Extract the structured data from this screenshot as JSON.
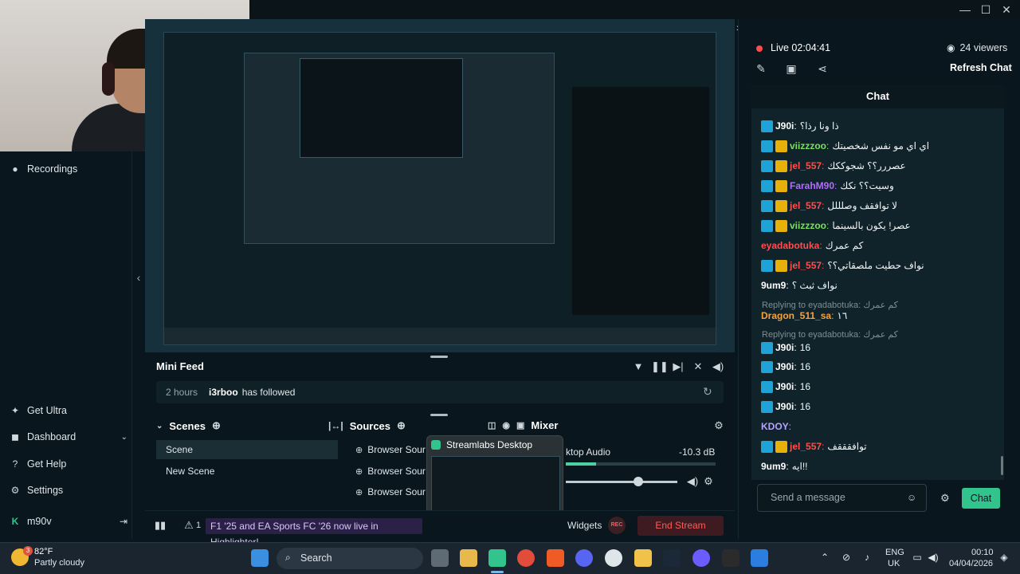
{
  "window": {
    "minimize": "—",
    "maximize": "☐",
    "close": "✕"
  },
  "sidebar": {
    "recordings": "Recordings",
    "get_ultra": "Get Ultra",
    "dashboard": "Dashboard",
    "get_help": "Get Help",
    "settings": "Settings",
    "user": "m90v"
  },
  "mini_feed": {
    "title": "Mini Feed",
    "event_time": "2 hours",
    "event_user": "i3rboo",
    "event_action": "has followed"
  },
  "scenes": {
    "title": "Scenes",
    "items": [
      "Scene",
      "New Scene"
    ]
  },
  "sources": {
    "title": "Sources",
    "items": [
      "Browser Sour",
      "Browser Sour",
      "Browser Sour"
    ]
  },
  "mixer": {
    "title": "Mixer",
    "device": "ktop Audio",
    "level": "-10.3 dB",
    "meter_fraction": 0.2,
    "volume_fraction": 0.65
  },
  "hover_preview": {
    "title": "Streamlabs Desktop"
  },
  "statusbar": {
    "promo": "F1 '25 and EA Sports FC '26 now live in Highlighter!",
    "widgets": "Widgets",
    "rec": "REC",
    "end_stream": "End Stream",
    "alert_count": "1"
  },
  "chat_panel": {
    "live_label": "Live",
    "live_time": "02:04:41",
    "viewers": "24 viewers",
    "refresh_chat": "Refresh Chat",
    "chat_title": "Chat",
    "send_placeholder": "Send a message",
    "chat_button": "Chat",
    "messages": [
      {
        "name": "J90i",
        "sep": ":",
        "text": "ذا ونا رذا؟",
        "color": "#ffffff",
        "badges": "mod"
      },
      {
        "name": "viizzzoo",
        "sep": ":",
        "text": "اي اي مو نفس شخصيتك",
        "color": "#7be05a",
        "badges": "mod-crown"
      },
      {
        "name": "jel_557",
        "sep": ":",
        "text": "عصررر؟؟ شجوككك",
        "color": "#ff4d4d",
        "badges": "mod-crown"
      },
      {
        "name": "FarahM90",
        "sep": ":",
        "text": "وسيت؟؟ نكك",
        "color": "#b36bff",
        "badges": "mod-crown"
      },
      {
        "name": "jel_557",
        "sep": ":",
        "text": "لا توافقف وصلللل",
        "color": "#ff4d4d",
        "badges": "mod-crown"
      },
      {
        "name": "viizzzoo",
        "sep": ":",
        "text": "عصر! يكون بالسينما",
        "color": "#7be05a",
        "badges": "mod-crown"
      },
      {
        "name": "eyadabotuka",
        "sep": ":",
        "text": "كم عمرك",
        "color": "#ff4d4d",
        "badges": ""
      },
      {
        "name": "jel_557",
        "sep": ":",
        "text": "نواف حطيت ملصقاتي؟؟",
        "color": "#ff4d4d",
        "badges": "mod-crown"
      },
      {
        "name": "9um9",
        "sep": ":",
        "text": "نواف ثبث ؟",
        "color": "#ffffff",
        "badges": ""
      },
      {
        "name": "Dragon_511_sa",
        "sep": ":",
        "text": "١٦",
        "color": "#f7a23b",
        "badges": ""
      },
      {
        "name": "J90i",
        "sep": ":",
        "text": "16",
        "color": "#ffffff",
        "badges": "mod"
      },
      {
        "name": "J90i",
        "sep": ":",
        "text": "16",
        "color": "#ffffff",
        "badges": "mod"
      },
      {
        "name": "J90i",
        "sep": ":",
        "text": "16",
        "color": "#ffffff",
        "badges": "mod"
      },
      {
        "name": "J90i",
        "sep": ":",
        "text": "16",
        "color": "#ffffff",
        "badges": "mod"
      },
      {
        "name": "KDOY",
        "sep": ":",
        "text": "",
        "color": "#b9a3ff",
        "badges": ""
      },
      {
        "name": "jel_557",
        "sep": ":",
        "text": "توافقققف",
        "color": "#ff4d4d",
        "badges": "mod-crown"
      },
      {
        "name": "9um9",
        "sep": ":",
        "text": "ايه!!",
        "color": "#ffffff",
        "badges": ""
      }
    ],
    "replies": [
      "Replying to eyadabotuka: كم عمرك",
      "Replying to eyadabotuka: كم عمرك"
    ]
  },
  "taskbar": {
    "temp": "82°F",
    "weather": "Partly cloudy",
    "weather_badge": "3",
    "search": "Search",
    "lang": "ENG",
    "region": "UK",
    "time": "00:10",
    "date": "04/04/2026"
  },
  "colors": {
    "accent": "#31c48d",
    "danger": "#ff5b5b",
    "live": "#ff4b4b"
  }
}
